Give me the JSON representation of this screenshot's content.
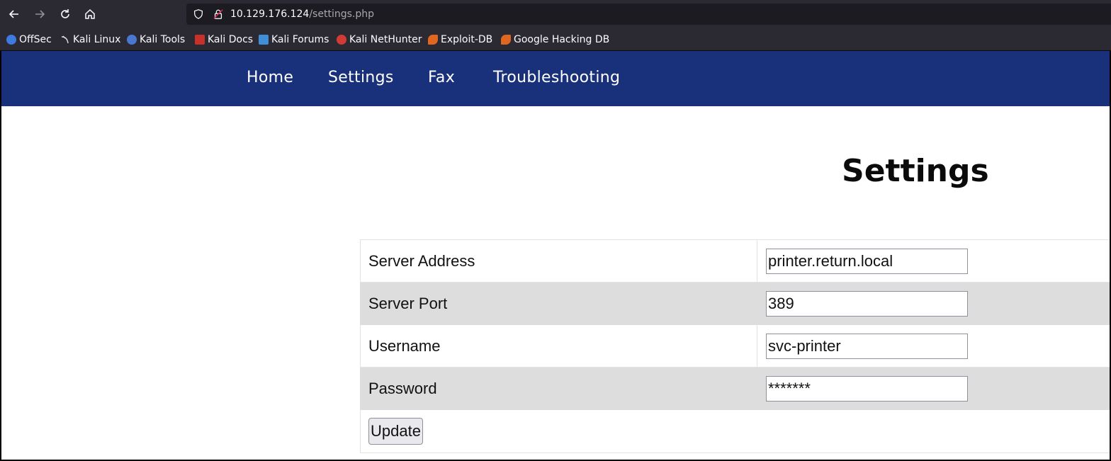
{
  "browser": {
    "url_host": "10.129.176.124",
    "url_path": "/settings.php",
    "bookmarks": [
      {
        "label": "OffSec",
        "icon": "offsec-icon",
        "color": "#3d7be0"
      },
      {
        "label": "Kali Linux",
        "icon": "kali-dragon-icon",
        "color": "#cccccc"
      },
      {
        "label": "Kali Tools",
        "icon": "kali-tools-icon",
        "color": "#4a78d0"
      },
      {
        "label": "Kali Docs",
        "icon": "kali-docs-icon",
        "color": "#c8302a"
      },
      {
        "label": "Kali Forums",
        "icon": "kali-forums-icon",
        "color": "#3f8fd8"
      },
      {
        "label": "Kali NetHunter",
        "icon": "nethunter-icon",
        "color": "#d23b35"
      },
      {
        "label": "Exploit-DB",
        "icon": "exploit-db-icon",
        "color": "#e0671f"
      },
      {
        "label": "Google Hacking DB",
        "icon": "ghdb-icon",
        "color": "#e0671f"
      }
    ]
  },
  "site": {
    "nav": {
      "home": "Home",
      "settings": "Settings",
      "fax": "Fax",
      "troubleshooting": "Troubleshooting"
    },
    "title": "Settings",
    "form": {
      "server_address_label": "Server Address",
      "server_address_value": "printer.return.local",
      "server_port_label": "Server Port",
      "server_port_value": "389",
      "username_label": "Username",
      "username_value": "svc-printer",
      "password_label": "Password",
      "password_value": "*******",
      "update_label": "Update"
    }
  },
  "colors": {
    "nav_bg": "#19317a",
    "row_alt": "#dddddd",
    "chrome": "#2b2a33"
  }
}
